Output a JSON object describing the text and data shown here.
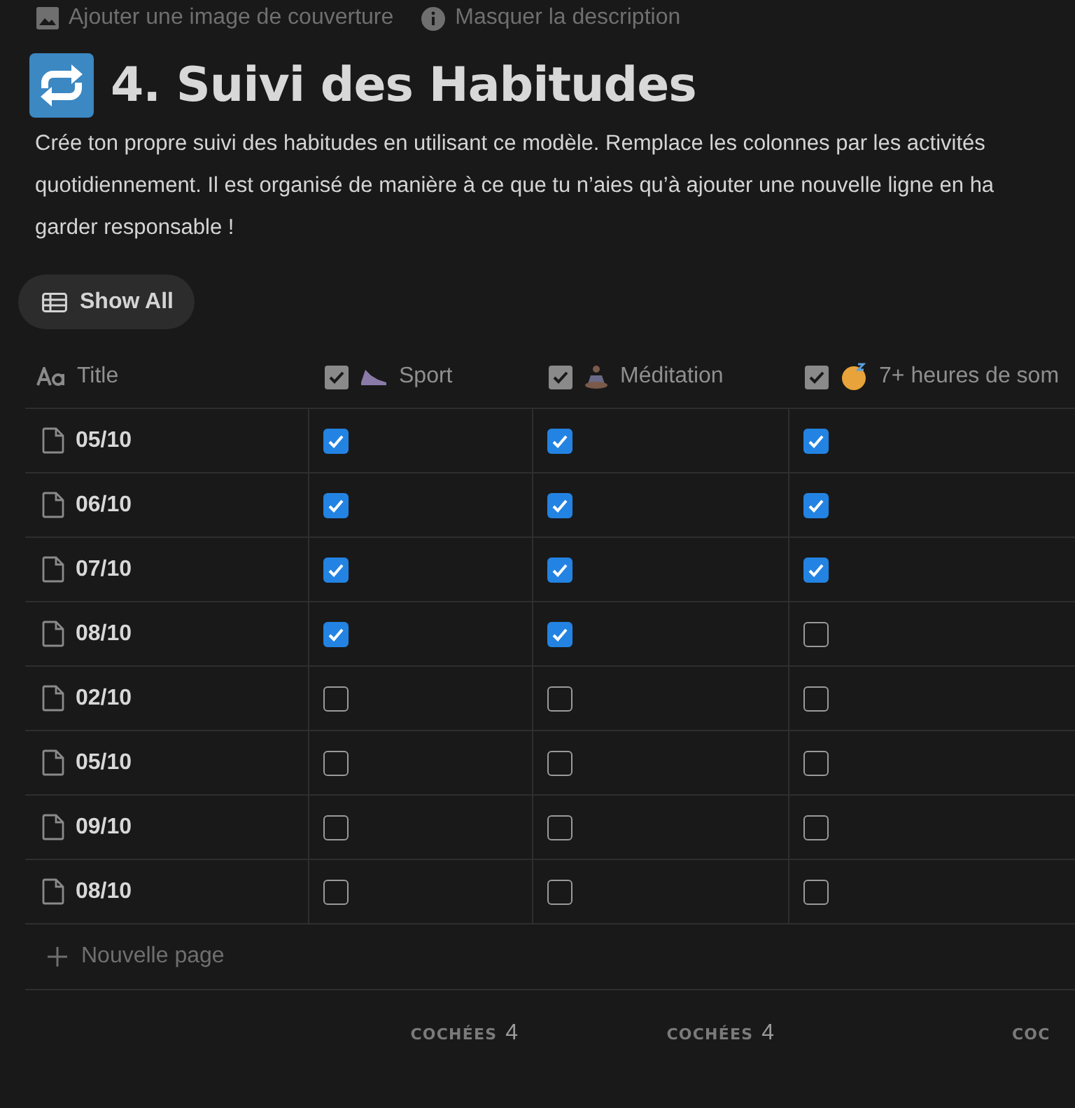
{
  "page_actions": [
    {
      "kind": "image",
      "label": "Ajouter une image de couverture"
    },
    {
      "kind": "info",
      "label": "Masquer la description"
    }
  ],
  "title": "4. Suivi des Habitudes",
  "description": [
    "Crée ton propre suivi des habitudes en utilisant ce modèle. Remplace les colonnes par les activités",
    "quotidiennement. Il est organisé de manière à ce que tu n’aies qu’à ajouter une nouvelle ligne en ha",
    "garder responsable !"
  ],
  "view_tab": {
    "label": "Show All",
    "selected": true
  },
  "table": {
    "columns": [
      {
        "kind": "title",
        "label": "Title"
      },
      {
        "kind": "checkbox",
        "label": "Sport"
      },
      {
        "kind": "checkbox",
        "label": "Méditation"
      },
      {
        "kind": "checkbox",
        "label": "7+ heures de som"
      }
    ],
    "rows": [
      {
        "title": "05/10",
        "checks": [
          true,
          true,
          true
        ]
      },
      {
        "title": "06/10",
        "checks": [
          true,
          true,
          true
        ]
      },
      {
        "title": "07/10",
        "checks": [
          true,
          true,
          true
        ]
      },
      {
        "title": "08/10",
        "checks": [
          true,
          true,
          false
        ]
      },
      {
        "title": "02/10",
        "checks": [
          false,
          false,
          false
        ]
      },
      {
        "title": "05/10",
        "checks": [
          false,
          false,
          false
        ]
      },
      {
        "title": "09/10",
        "checks": [
          false,
          false,
          false
        ]
      },
      {
        "title": "08/10",
        "checks": [
          false,
          false,
          false
        ]
      }
    ],
    "new_row": "Nouvelle page",
    "footer": [
      {
        "label": "COCHÉES",
        "value": "4"
      },
      {
        "label": "COCHÉES",
        "value": "4"
      },
      {
        "label": "COC"
      }
    ]
  }
}
